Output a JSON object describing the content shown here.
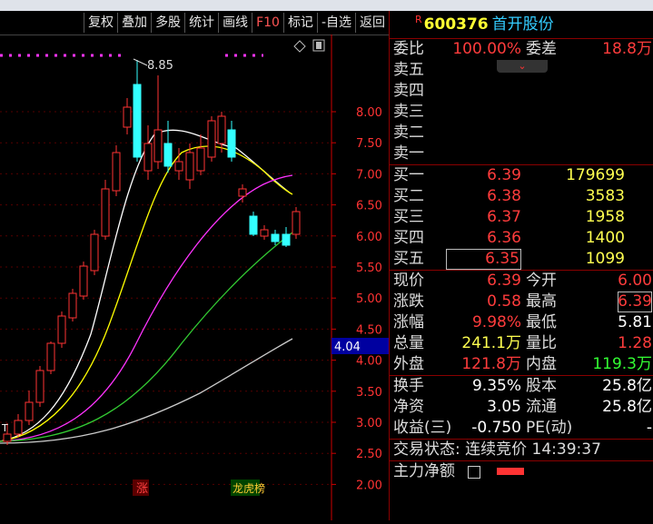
{
  "toolbar": {
    "buttons": [
      "复权",
      "叠加",
      "多股",
      "统计",
      "画线",
      "F10",
      "标记",
      "-自选",
      "返回"
    ],
    "active_index": 5
  },
  "chart": {
    "max_label": "8.85",
    "current_price_tag": "4.04",
    "price_ticks": [
      "8.00",
      "7.50",
      "7.00",
      "6.50",
      "6.00",
      "5.50",
      "5.00",
      "4.50",
      "4.00",
      "3.50",
      "3.00",
      "2.50",
      "2.00"
    ],
    "bottom_labels": [
      "涨",
      "龙虎榜"
    ],
    "marker_t": "T",
    "colors": {
      "up": "#ff3333",
      "down": "#33ffff",
      "ma5": "#ffffff",
      "ma10": "#ffff00",
      "ma20": "#ff33ff",
      "ma60": "#33cc33",
      "ma120": "#cccccc",
      "axis": "#cc0000"
    }
  },
  "quote": {
    "r_mark": "R",
    "code": "600376",
    "name": "首开股份",
    "weibi": {
      "label": "委比",
      "value": "100.00%",
      "label2": "委差",
      "value2": "18.8万"
    },
    "sell": [
      {
        "label": "卖五",
        "price": "",
        "vol": ""
      },
      {
        "label": "卖四",
        "price": "",
        "vol": ""
      },
      {
        "label": "卖三",
        "price": "",
        "vol": ""
      },
      {
        "label": "卖二",
        "price": "",
        "vol": ""
      },
      {
        "label": "卖一",
        "price": "",
        "vol": ""
      }
    ],
    "buy": [
      {
        "label": "买一",
        "price": "6.39",
        "vol": "179699"
      },
      {
        "label": "买二",
        "price": "6.38",
        "vol": "3583"
      },
      {
        "label": "买三",
        "price": "6.37",
        "vol": "1958"
      },
      {
        "label": "买四",
        "price": "6.36",
        "vol": "1400"
      },
      {
        "label": "买五",
        "price": "6.35",
        "vol": "1099"
      }
    ],
    "stats": [
      {
        "l1": "现价",
        "v1": "6.39",
        "c1": "red",
        "l2": "今开",
        "v2": "6.00",
        "c2": "red"
      },
      {
        "l1": "涨跌",
        "v1": "0.58",
        "c1": "red",
        "l2": "最高",
        "v2": "6.39",
        "c2": "red"
      },
      {
        "l1": "涨幅",
        "v1": "9.98%",
        "c1": "red",
        "l2": "最低",
        "v2": "5.81",
        "c2": "wht"
      },
      {
        "l1": "总量",
        "v1": "241.1万",
        "c1": "yel",
        "l2": "量比",
        "v2": "1.28",
        "c2": "red"
      },
      {
        "l1": "外盘",
        "v1": "121.8万",
        "c1": "red",
        "l2": "内盘",
        "v2": "119.3万",
        "c2": "grn"
      }
    ],
    "fin": [
      {
        "l1": "换手",
        "v1": "9.35%",
        "l2": "股本",
        "v2": "25.8亿"
      },
      {
        "l1": "净资",
        "v1": "3.05",
        "l2": "流通",
        "v2": "25.8亿"
      },
      {
        "l1": "收益(三)",
        "v1": "-0.750",
        "l2": "PE(动)",
        "v2": "-"
      }
    ],
    "trade_status": "交易状态: 连续竞价 14:39:37",
    "main_flow_label": "主力净额"
  }
}
